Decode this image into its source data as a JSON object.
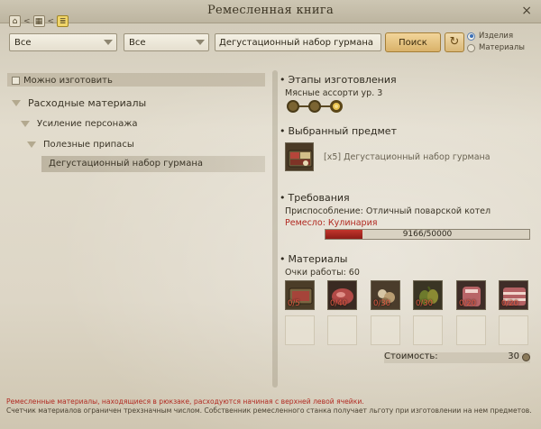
{
  "window": {
    "title": "Ремесленная книга",
    "close_glyph": "×",
    "nav": {
      "home_glyph": "⌂",
      "back_glyph": "<",
      "grid_glyph": "▦",
      "back2_glyph": "<",
      "list_glyph": "≣"
    }
  },
  "filters": {
    "select1_value": "Все",
    "select2_value": "Все",
    "search_value": "Дегустационный набор гурмана",
    "search_button": "Поиск",
    "refresh_glyph": "↻",
    "radio_options": [
      "Изделия",
      "Материалы"
    ],
    "radio_selected": "Изделия"
  },
  "tree": {
    "can_make_label": "Можно изготовить",
    "items": [
      {
        "label": "Расходные материалы",
        "level": 0
      },
      {
        "label": "Усиление персонажа",
        "level": 1
      },
      {
        "label": "Полезные припасы",
        "level": 2
      },
      {
        "label": "Дегустационный набор гурмана",
        "level": 3,
        "selected": true
      }
    ]
  },
  "details": {
    "stages_title": "Этапы изготовления",
    "stages_subtitle": "Мясные ассорти ур. 3",
    "stages_total": 3,
    "stage_current": 3,
    "selected_title": "Выбранный предмет",
    "selected_item": "[x5] Дегустационный набор гурмана",
    "requirements_title": "Требования",
    "tool_requirement": "Приспособление: Отличный поварской котел",
    "craft_requirement": "Ремесло: Кулинария",
    "craft_progress_text": "9166/50000",
    "craft_progress_value": 9166,
    "craft_progress_max": 50000,
    "materials_title": "Материалы",
    "work_points": "Очки работы: 60",
    "materials": [
      {
        "count": "0/5",
        "icon": "meat-tray-icon"
      },
      {
        "count": "0/40",
        "icon": "raw-meat-icon"
      },
      {
        "count": "0/30",
        "icon": "spice-icon"
      },
      {
        "count": "0/30",
        "icon": "olive-icon"
      },
      {
        "count": "0/20",
        "icon": "ham-icon"
      },
      {
        "count": "0/20",
        "icon": "bacon-icon"
      }
    ],
    "cost_label": "Стоимость:",
    "cost_value": "30"
  },
  "footer": {
    "warning": "Ремесленные материалы, находящиеся в рюкзаке, расходуются начиная с верхней левой ячейки.",
    "note": "Счетчик материалов ограничен трехзначным числом. Собственник ремесленного станка получает льготу при изготовлении на нем предметов."
  },
  "colors": {
    "accent_red": "#b12a22",
    "progress_fill": "#c3352c",
    "button_gold": "#d9b26a"
  }
}
